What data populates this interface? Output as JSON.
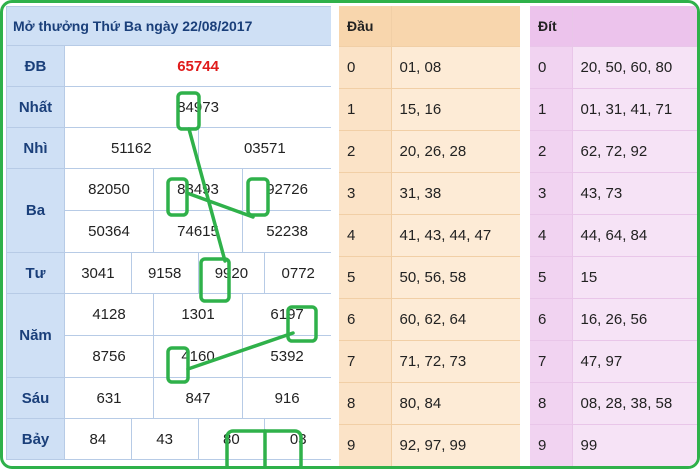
{
  "title": "Mở thưởng Thứ Ba ngày 22/08/2017",
  "results": [
    {
      "label": "ĐB",
      "rows": [
        [
          "65744"
        ]
      ],
      "special": true
    },
    {
      "label": "Nhất",
      "rows": [
        [
          "84973"
        ]
      ]
    },
    {
      "label": "Nhì",
      "rows": [
        [
          "51162",
          "03571"
        ]
      ]
    },
    {
      "label": "Ba",
      "rows": [
        [
          "82050",
          "83493",
          "92726"
        ],
        [
          "50364",
          "74615",
          "52238"
        ]
      ]
    },
    {
      "label": "Tư",
      "rows": [
        [
          "3041",
          "9158",
          "9920",
          "0772"
        ]
      ]
    },
    {
      "label": "Năm",
      "rows": [
        [
          "4128",
          "1301",
          "6197"
        ],
        [
          "8756",
          "4160",
          "5392"
        ]
      ]
    },
    {
      "label": "Sáu",
      "rows": [
        [
          "631",
          "847",
          "916"
        ]
      ]
    },
    {
      "label": "Bảy",
      "rows": [
        [
          "84",
          "43",
          "80",
          "03"
        ]
      ]
    }
  ],
  "dau": {
    "header": "Đầu",
    "rows": [
      {
        "key": "0",
        "value": "01, 08"
      },
      {
        "key": "1",
        "value": "15, 16"
      },
      {
        "key": "2",
        "value": "20, 26, 28"
      },
      {
        "key": "3",
        "value": "31, 38"
      },
      {
        "key": "4",
        "value": "41, 43, 44, 47"
      },
      {
        "key": "5",
        "value": "50, 56, 58"
      },
      {
        "key": "6",
        "value": "60, 62, 64"
      },
      {
        "key": "7",
        "value": "71, 72, 73"
      },
      {
        "key": "8",
        "value": "80, 84"
      },
      {
        "key": "9",
        "value": "92, 97, 99"
      }
    ]
  },
  "dit": {
    "header": "Đít",
    "rows": [
      {
        "key": "0",
        "value": "20, 50, 60, 80"
      },
      {
        "key": "1",
        "value": "01, 31, 41, 71"
      },
      {
        "key": "2",
        "value": "62, 72, 92"
      },
      {
        "key": "3",
        "value": "43, 73"
      },
      {
        "key": "4",
        "value": "44, 64, 84"
      },
      {
        "key": "5",
        "value": "15"
      },
      {
        "key": "6",
        "value": "16, 26, 56"
      },
      {
        "key": "7",
        "value": "47, 97"
      },
      {
        "key": "8",
        "value": "08, 28, 38, 58"
      },
      {
        "key": "9",
        "value": "99"
      }
    ]
  },
  "colors": {
    "highlight": "#2fb14a",
    "special": "#e01b1b"
  }
}
